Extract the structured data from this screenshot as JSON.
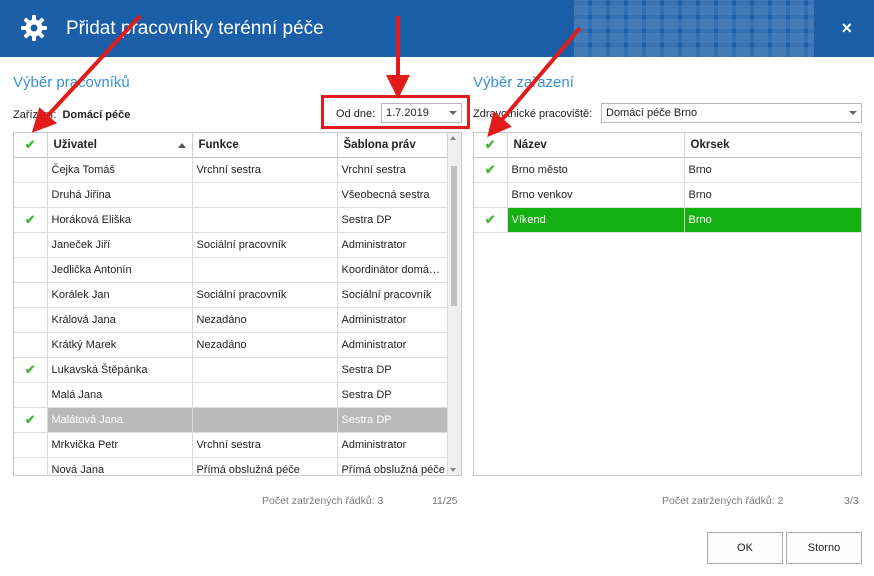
{
  "dialog": {
    "title": "Přidat pracovníky terénní péče",
    "close_label": "×"
  },
  "left": {
    "section_title": "Výběr pracovníků",
    "facility_label": "Zařízení:",
    "facility_value": "Domácí péče",
    "date_label": "Od dne:",
    "date_value": "1.7.2019",
    "columns": [
      "Uživatel",
      "Funkce",
      "Šablona práv"
    ],
    "rows": [
      {
        "checked": false,
        "user": "Čejka Tomáš",
        "function": "Vrchní sestra",
        "template": "Vrchní sestra"
      },
      {
        "checked": false,
        "user": "Druhá Jiřina",
        "function": "",
        "template": "Všeobecná sestra"
      },
      {
        "checked": true,
        "user": "Horáková Eliška",
        "function": "",
        "template": "Sestra DP"
      },
      {
        "checked": false,
        "user": "Janeček Jiří",
        "function": "Sociální pracovník",
        "template": "Administrator"
      },
      {
        "checked": false,
        "user": "Jedlička Antonín",
        "function": "",
        "template": "Koordinátor domá…"
      },
      {
        "checked": false,
        "user": "Korálek Jan",
        "function": "Sociální pracovník",
        "template": "Sociální pracovník"
      },
      {
        "checked": false,
        "user": "Králová Jana",
        "function": "Nezadáno",
        "template": "Administrator"
      },
      {
        "checked": false,
        "user": "Krátký Marek",
        "function": "Nezadáno",
        "template": "Administrator"
      },
      {
        "checked": true,
        "user": "Lukavská Štěpánka",
        "function": "",
        "template": "Sestra DP"
      },
      {
        "checked": false,
        "user": "Malá Jana",
        "function": "",
        "template": "Sestra DP"
      },
      {
        "checked": true,
        "user": "Malátová Jana",
        "function": "",
        "template": "Sestra DP",
        "selected": true
      },
      {
        "checked": false,
        "user": "Mrkvička Petr",
        "function": "Vrchní sestra",
        "template": "Administrator"
      },
      {
        "checked": false,
        "user": "Nová Jana",
        "function": "Přímá obslužná péče",
        "template": "Přímá obslužná péče"
      }
    ],
    "status_label": "Počet zatržených řádků: 3",
    "status_count": "11/25"
  },
  "right": {
    "section_title": "Výběr zařazení",
    "workplace_label": "Zdravotnické pracoviště:",
    "workplace_value": "Domácí péče Brno",
    "columns": [
      "Název",
      "Okrsek"
    ],
    "rows": [
      {
        "checked": true,
        "name": "Brno město",
        "district": "Brno"
      },
      {
        "checked": false,
        "name": "Brno venkov",
        "district": "Brno"
      },
      {
        "checked": true,
        "name": "Víkend",
        "district": "Brno",
        "selected": true
      }
    ],
    "status_label": "Počet zatržených řádků: 2",
    "status_count": "3/3"
  },
  "buttons": {
    "ok": "OK",
    "cancel": "Storno"
  },
  "icons": {
    "check": "✔",
    "gear": "gear-icon"
  },
  "colors": {
    "title_bar": "#1a5fa8",
    "accent_text": "#3a8fd6",
    "check_green": "#4cb53d",
    "selected_green": "#15b012",
    "highlight_red": "#e21b1b"
  }
}
